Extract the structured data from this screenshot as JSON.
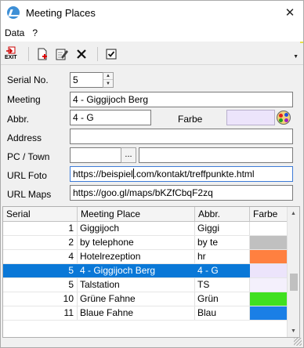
{
  "window": {
    "title": "Meeting Places",
    "close_glyph": "✕"
  },
  "menu": {
    "items": [
      "Data",
      "?"
    ]
  },
  "toolbar": {
    "exit_label": "EXIT",
    "icons": [
      "exit-icon",
      "new-record-icon",
      "edit-record-icon",
      "delete-icon",
      "checkbox-icon"
    ]
  },
  "form": {
    "serial_label": "Serial No.",
    "serial_value": "5",
    "meeting_label": "Meeting",
    "meeting_value": "4 - Giggijoch Berg",
    "abbr_label": "Abbr.",
    "abbr_value": "4 - G",
    "farbe_label": "Farbe",
    "farbe_color": "#ece4fb",
    "address_label": "Address",
    "address_value": "",
    "pctown_label": "PC / Town",
    "pc_value": "",
    "town_value": "",
    "browse_label": "...",
    "urlfoto_label": "URL Foto",
    "urlfoto_before_caret": "https://beispiel",
    "urlfoto_after_caret": ".com/kontakt/treffpunkte.html",
    "urlmaps_label": "URL Maps",
    "urlmaps_value": "https://goo.gl/maps/bKZfCbqF2zq"
  },
  "grid": {
    "columns": [
      "Serial",
      "Meeting Place",
      "Abbr.",
      "Farbe"
    ],
    "selected_row": 3,
    "rows": [
      {
        "serial": "1",
        "place": "Giggijoch",
        "abbr": "Giggi",
        "color": "#ffffff"
      },
      {
        "serial": "2",
        "place": "by telephone",
        "abbr": "by te",
        "color": "#c0c0c0"
      },
      {
        "serial": "4",
        "place": "Hotelrezeption",
        "abbr": "hr",
        "color": "#ff8040"
      },
      {
        "serial": "5",
        "place": "4 - Giggijoch Berg",
        "abbr": "4 - G",
        "color": "#ece4fb"
      },
      {
        "serial": "5",
        "place": "Talstation",
        "abbr": "TS",
        "color": "#f4f0fc"
      },
      {
        "serial": "10",
        "place": "Grüne Fahne",
        "abbr": "Grün",
        "color": "#40e020"
      },
      {
        "serial": "11",
        "place": "Blaue Fahne",
        "abbr": "Blau",
        "color": "#1a7fe6"
      }
    ]
  }
}
